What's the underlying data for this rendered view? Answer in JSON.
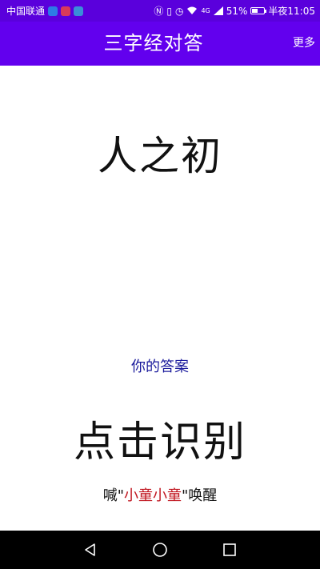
{
  "status_bar": {
    "carrier": "中国联通",
    "network_type": "4G",
    "battery_percent": "51%",
    "time": "半夜11:05",
    "battery_level": 0.51,
    "icons": [
      "shield-icon",
      "microphone-icon",
      "app-icon",
      "nfc-icon",
      "vibrate-icon",
      "alarm-icon",
      "wifi-icon",
      "signal-icon",
      "battery-icon"
    ]
  },
  "app_bar": {
    "title": "三字经对答",
    "more_label": "更多",
    "background": "#6200ee"
  },
  "main": {
    "question": "人之初",
    "answer_label": "你的答案",
    "recognize_label": "点击识别",
    "wake_prefix": "喊\"",
    "wake_word": "小童小童",
    "wake_suffix": "\"唤醒"
  },
  "colors": {
    "status_bar": "#5a00dc",
    "answer_label": "#1a1a9c",
    "wake_word": "#c0141e"
  },
  "nav_bar": {
    "icons": [
      "back-icon",
      "home-icon",
      "recents-icon"
    ]
  }
}
